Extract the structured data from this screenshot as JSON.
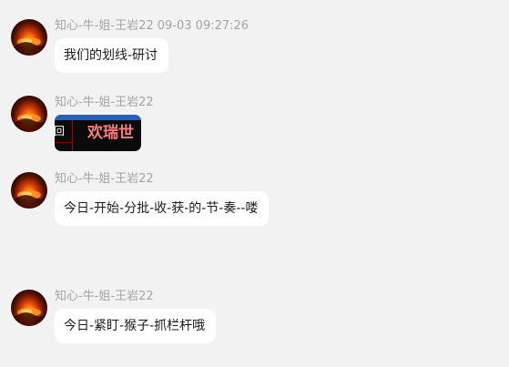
{
  "messages": [
    {
      "sender": "知心-牛-姐-王岩22",
      "timestamp": "09-03 09:27:26",
      "text": "我们的划线-研讨"
    },
    {
      "sender": "知心-牛-姐-王岩22",
      "image": {
        "side_text": "回",
        "banner_text": "欢瑞世"
      }
    },
    {
      "sender": "知心-牛-姐-王岩22",
      "text": "今日-开始-分批-收-获-的-节-奏--喽"
    },
    {
      "sender": "知心-牛-姐-王岩22",
      "text": "今日-紧盯-猴子-抓栏杆哦"
    }
  ],
  "colors": {
    "background": "#f2f2f2",
    "bubble": "#ffffff",
    "meta_text": "#a3a3a3",
    "image_banner_text": "#ff7b7b",
    "image_top_bar": "#1e63c3"
  }
}
